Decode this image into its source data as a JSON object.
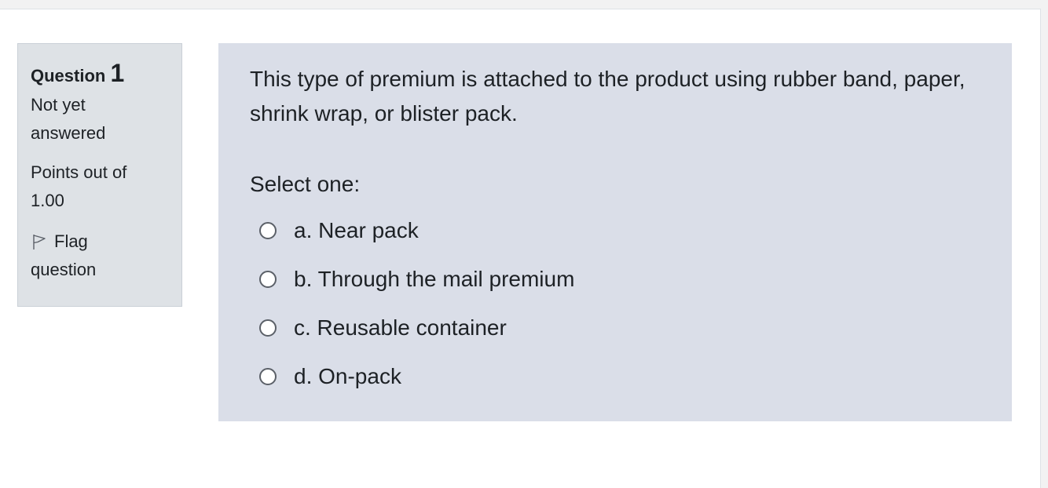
{
  "question_info": {
    "label": "Question",
    "number": "1",
    "state": "Not yet answered",
    "grade": "Points out of 1.00",
    "flag_label": "Flag question",
    "flag_icon": "flag-icon"
  },
  "question": {
    "text": "This type of premium is attached to the product using rubber band, paper, shrink wrap, or blister pack.",
    "prompt": "Select one:",
    "answers": [
      {
        "label": "a. Near pack",
        "selected": false
      },
      {
        "label": "b. Through the mail premium",
        "selected": false
      },
      {
        "label": "c. Reusable container",
        "selected": false
      },
      {
        "label": "d. On-pack",
        "selected": false
      }
    ]
  },
  "colors": {
    "info_background": "#dee2e6",
    "content_background": "#dadee8",
    "text": "#1d2125"
  }
}
